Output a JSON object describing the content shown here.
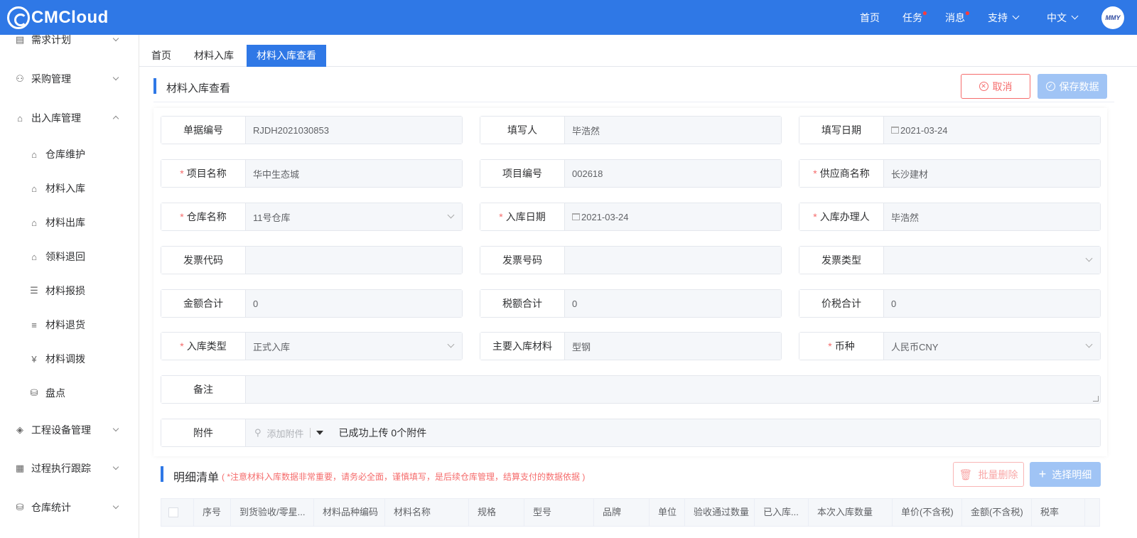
{
  "brand": {
    "name": "CMCloud"
  },
  "topnav": {
    "home": "首页",
    "tasks": "任务",
    "messages": "消息",
    "support": "支持",
    "language": "中文",
    "avatar_text": "MMY"
  },
  "sidebar": {
    "items": [
      {
        "label": "需求计划",
        "icon": "plan-icon",
        "expanded": false
      },
      {
        "label": "采购管理",
        "icon": "org-icon",
        "expanded": false
      },
      {
        "label": "出入库管理",
        "icon": "warehouse-icon",
        "expanded": true
      },
      {
        "label": "仓库维护",
        "icon": "home-icon"
      },
      {
        "label": "材料入库",
        "icon": "inbound-icon"
      },
      {
        "label": "材料出库",
        "icon": "outbound-icon"
      },
      {
        "label": "领料退回",
        "icon": "return-icon"
      },
      {
        "label": "材料报损",
        "icon": "document-icon"
      },
      {
        "label": "材料退货",
        "icon": "stack-icon"
      },
      {
        "label": "材料调拨",
        "icon": "transfer-icon"
      },
      {
        "label": "盘点",
        "icon": "database-icon"
      },
      {
        "label": "工程设备管理",
        "icon": "box-icon",
        "expanded": false
      },
      {
        "label": "过程执行跟踪",
        "icon": "chart-icon",
        "expanded": false
      },
      {
        "label": "仓库统计",
        "icon": "coins-icon",
        "expanded": false
      }
    ]
  },
  "tabs": [
    {
      "label": "首页"
    },
    {
      "label": "材料入库"
    },
    {
      "label": "材料入库查看",
      "active": true
    }
  ],
  "page": {
    "title": "材料入库查看",
    "cancel": "取消",
    "save": "保存数据"
  },
  "form": {
    "doc_no": {
      "label": "单据编号",
      "value": "RJDH2021030853"
    },
    "writer": {
      "label": "填写人",
      "value": "毕浩然"
    },
    "write_date": {
      "label": "填写日期",
      "value": "2021-03-24"
    },
    "project_name": {
      "label": "项目名称",
      "value": "华中生态城"
    },
    "project_no": {
      "label": "项目编号",
      "value": "002618"
    },
    "supplier": {
      "label": "供应商名称",
      "value": "长沙建材"
    },
    "warehouse": {
      "label": "仓库名称",
      "value": "11号仓库"
    },
    "in_date": {
      "label": "入库日期",
      "value": "2021-03-24"
    },
    "handler": {
      "label": "入库办理人",
      "value": "毕浩然"
    },
    "invoice_code": {
      "label": "发票代码",
      "value": ""
    },
    "invoice_no": {
      "label": "发票号码",
      "value": ""
    },
    "invoice_type": {
      "label": "发票类型",
      "value": ""
    },
    "amount_total": {
      "label": "金额合计",
      "value": "0"
    },
    "tax_total": {
      "label": "税额合计",
      "value": "0"
    },
    "price_tax_total": {
      "label": "价税合计",
      "value": "0"
    },
    "in_type": {
      "label": "入库类型",
      "value": "正式入库"
    },
    "main_material": {
      "label": "主要入库材料",
      "value": "型钢"
    },
    "currency": {
      "label": "币种",
      "value": "人民币CNY"
    },
    "remark": {
      "label": "备注",
      "value": ""
    },
    "attachment": {
      "label": "附件",
      "add": "添加附件",
      "info": "已成功上传 0个附件"
    },
    "required_mark": "*"
  },
  "detail": {
    "title": "明细清单",
    "note": "( *注意材料入库数据非常重要，请务必全面，谨慎填写，是后续仓库管理，结算支付的数据依据 )",
    "batch_delete": "批量删除",
    "select_detail": "选择明细",
    "columns": [
      "序号",
      "到货验收/零星...",
      "材料品种编码",
      "材料名称",
      "规格",
      "型号",
      "品牌",
      "单位",
      "验收通过数量",
      "已入库...",
      "本次入库数量",
      "单价(不含税)",
      "金额(不含税)",
      "税率"
    ]
  }
}
